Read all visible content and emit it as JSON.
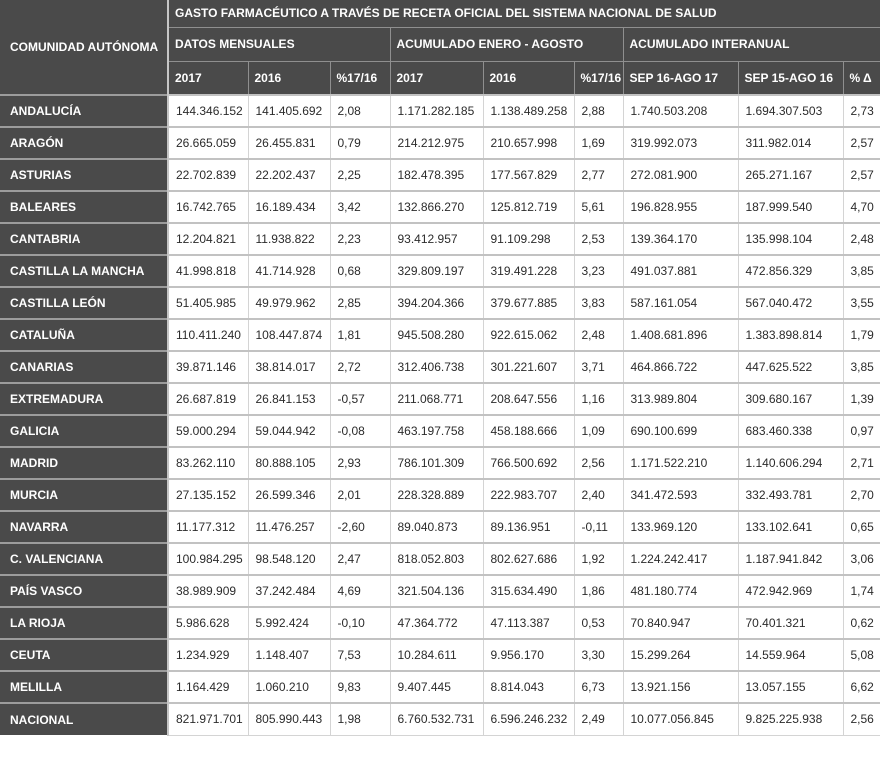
{
  "chart_data": {
    "type": "table",
    "title": "GASTO FARMACÉUTICO A TRAVÉS DE RECETA OFICIAL DEL SISTEMA NACIONAL DE SALUD",
    "corner_header": "COMUNIDAD AUTÓNOMA",
    "column_groups": [
      {
        "label": "DATOS MENSUALES",
        "span": 3
      },
      {
        "label": "ACUMULADO ENERO - AGOSTO",
        "span": 3
      },
      {
        "label": "ACUMULADO INTERANUAL",
        "span": 3
      }
    ],
    "columns": [
      "2017",
      "2016",
      "%17/16",
      "2017",
      "2016",
      "%17/16",
      "SEP 16-AGO 17",
      "SEP 15-AGO 16",
      "% Δ"
    ],
    "rows": [
      {
        "name": "ANDALUCÍA",
        "values": [
          "144.346.152",
          "141.405.692",
          "2,08",
          "1.171.282.185",
          "1.138.489.258",
          "2,88",
          "1.740.503.208",
          "1.694.307.503",
          "2,73"
        ]
      },
      {
        "name": "ARAGÓN",
        "values": [
          "26.665.059",
          "26.455.831",
          "0,79",
          "214.212.975",
          "210.657.998",
          "1,69",
          "319.992.073",
          "311.982.014",
          "2,57"
        ]
      },
      {
        "name": "ASTURIAS",
        "values": [
          "22.702.839",
          "22.202.437",
          "2,25",
          "182.478.395",
          "177.567.829",
          "2,77",
          "272.081.900",
          "265.271.167",
          "2,57"
        ]
      },
      {
        "name": "BALEARES",
        "values": [
          "16.742.765",
          "16.189.434",
          "3,42",
          "132.866.270",
          "125.812.719",
          "5,61",
          "196.828.955",
          "187.999.540",
          "4,70"
        ]
      },
      {
        "name": "CANTABRIA",
        "values": [
          "12.204.821",
          "11.938.822",
          "2,23",
          "93.412.957",
          "91.109.298",
          "2,53",
          "139.364.170",
          "135.998.104",
          "2,48"
        ]
      },
      {
        "name": "CASTILLA LA MANCHA",
        "values": [
          "41.998.818",
          "41.714.928",
          "0,68",
          "329.809.197",
          "319.491.228",
          "3,23",
          "491.037.881",
          "472.856.329",
          "3,85"
        ]
      },
      {
        "name": "CASTILLA LEÓN",
        "values": [
          "51.405.985",
          "49.979.962",
          "2,85",
          "394.204.366",
          "379.677.885",
          "3,83",
          "587.161.054",
          "567.040.472",
          "3,55"
        ]
      },
      {
        "name": "CATALUÑA",
        "values": [
          "110.411.240",
          "108.447.874",
          "1,81",
          "945.508.280",
          "922.615.062",
          "2,48",
          "1.408.681.896",
          "1.383.898.814",
          "1,79"
        ]
      },
      {
        "name": "CANARIAS",
        "values": [
          "39.871.146",
          "38.814.017",
          "2,72",
          "312.406.738",
          "301.221.607",
          "3,71",
          "464.866.722",
          "447.625.522",
          "3,85"
        ]
      },
      {
        "name": "EXTREMADURA",
        "values": [
          "26.687.819",
          "26.841.153",
          "-0,57",
          "211.068.771",
          "208.647.556",
          "1,16",
          "313.989.804",
          "309.680.167",
          "1,39"
        ]
      },
      {
        "name": "GALICIA",
        "values": [
          "59.000.294",
          "59.044.942",
          "-0,08",
          "463.197.758",
          "458.188.666",
          "1,09",
          "690.100.699",
          "683.460.338",
          "0,97"
        ]
      },
      {
        "name": "MADRID",
        "values": [
          "83.262.110",
          "80.888.105",
          "2,93",
          "786.101.309",
          "766.500.692",
          "2,56",
          "1.171.522.210",
          "1.140.606.294",
          "2,71"
        ]
      },
      {
        "name": "MURCIA",
        "values": [
          "27.135.152",
          "26.599.346",
          "2,01",
          "228.328.889",
          "222.983.707",
          "2,40",
          "341.472.593",
          "332.493.781",
          "2,70"
        ]
      },
      {
        "name": "NAVARRA",
        "values": [
          "11.177.312",
          "11.476.257",
          "-2,60",
          "89.040.873",
          "89.136.951",
          "-0,11",
          "133.969.120",
          "133.102.641",
          "0,65"
        ]
      },
      {
        "name": "C. VALENCIANA",
        "values": [
          "100.984.295",
          "98.548.120",
          "2,47",
          "818.052.803",
          "802.627.686",
          "1,92",
          "1.224.242.417",
          "1.187.941.842",
          "3,06"
        ]
      },
      {
        "name": "PAÍS VASCO",
        "values": [
          "38.989.909",
          "37.242.484",
          "4,69",
          "321.504.136",
          "315.634.490",
          "1,86",
          "481.180.774",
          "472.942.969",
          "1,74"
        ]
      },
      {
        "name": "LA RIOJA",
        "values": [
          "5.986.628",
          "5.992.424",
          "-0,10",
          "47.364.772",
          "47.113.387",
          "0,53",
          "70.840.947",
          "70.401.321",
          "0,62"
        ]
      },
      {
        "name": "CEUTA",
        "values": [
          "1.234.929",
          "1.148.407",
          "7,53",
          "10.284.611",
          "9.956.170",
          "3,30",
          "15.299.264",
          "14.559.964",
          "5,08"
        ]
      },
      {
        "name": "MELILLA",
        "values": [
          "1.164.429",
          "1.060.210",
          "9,83",
          "9.407.445",
          "8.814.043",
          "6,73",
          "13.921.156",
          "13.057.155",
          "6,62"
        ]
      },
      {
        "name": "NACIONAL",
        "values": [
          "821.971.701",
          "805.990.443",
          "1,98",
          "6.760.532.731",
          "6.596.246.232",
          "2,49",
          "10.077.056.845",
          "9.825.225.938",
          "2,56"
        ]
      }
    ],
    "layout": {
      "grid": true,
      "legend": "none"
    },
    "colors": {
      "header_bg": "#4a4a4a",
      "header_text": "#ffffff",
      "cell_bg": "#ffffff",
      "cell_text": "#2b2b2b",
      "separator": "#c2c2c2"
    }
  }
}
